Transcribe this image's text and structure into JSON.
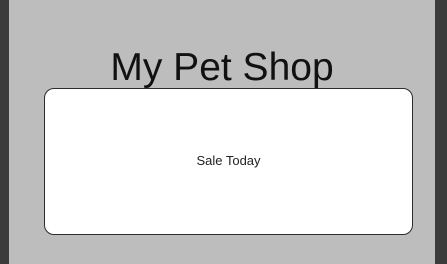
{
  "app": {
    "title": "My Pet Shop"
  },
  "banner": {
    "text": "Sale Today"
  },
  "colors": {
    "frame": "#3b3b3b",
    "screen_background": "#bdbdbd",
    "card_background": "#ffffff",
    "card_border": "#2c2c2c",
    "text": "#111111"
  }
}
